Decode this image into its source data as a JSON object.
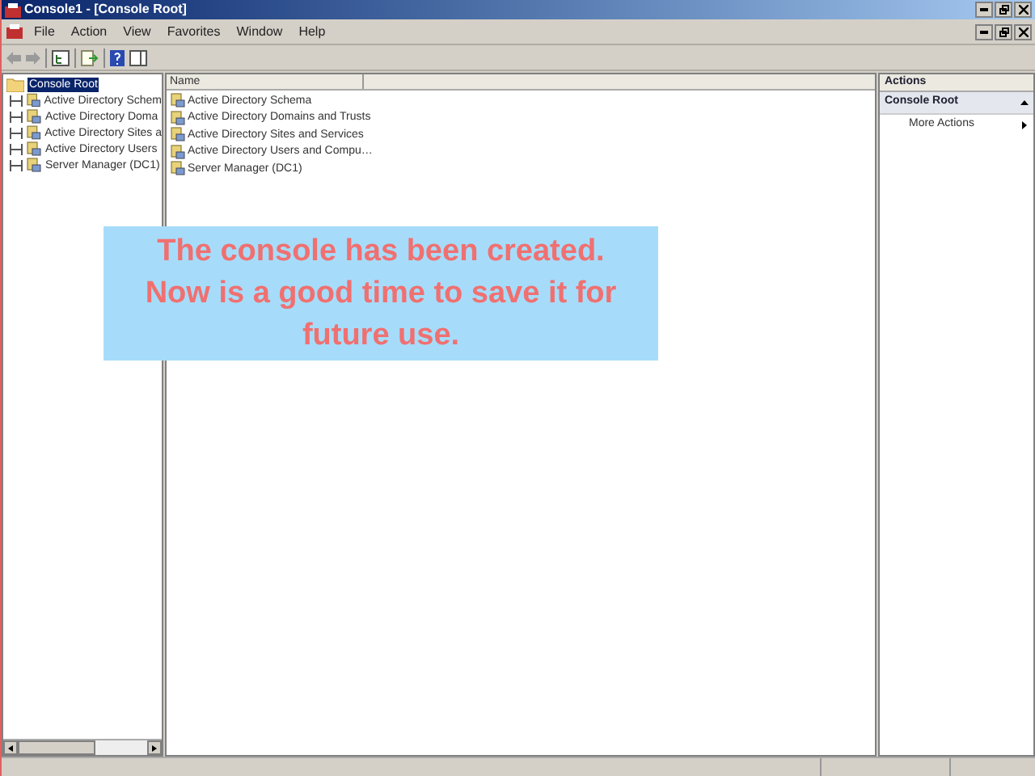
{
  "window": {
    "title": "Console1 - [Console Root]"
  },
  "menu": [
    "File",
    "Action",
    "View",
    "Favorites",
    "Window",
    "Help"
  ],
  "tree": {
    "label": "Console Root",
    "selected": true,
    "children": [
      {
        "label": "Active Directory Schem",
        "selected": false
      },
      {
        "label": "Active Directory Doma",
        "selected": false
      },
      {
        "label": "Active Directory Sites a",
        "selected": false
      },
      {
        "label": "Active Directory Users",
        "selected": false
      },
      {
        "label": "Server Manager (DC1)",
        "selected": false
      }
    ]
  },
  "list": {
    "columns": [
      "Name"
    ],
    "rows": [
      {
        "name": "Active Directory Schema"
      },
      {
        "name": "Active Directory Domains and Trusts"
      },
      {
        "name": "Active Directory Sites and Services"
      },
      {
        "name": "Active Directory Users and Compu…"
      },
      {
        "name": "Server Manager (DC1)"
      }
    ]
  },
  "actions": {
    "title": "Actions",
    "section": "Console Root",
    "items": [
      "More Actions"
    ]
  },
  "callout": {
    "text": "The console has been created. Now is a good time to save it for future use."
  }
}
